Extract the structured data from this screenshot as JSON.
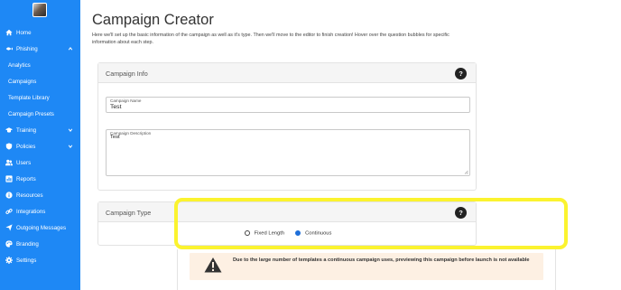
{
  "sidebar": {
    "items": [
      {
        "label": "Home",
        "icon": "home-icon",
        "chevron": false
      },
      {
        "label": "Phishing",
        "icon": "fish-icon",
        "chevron": "up"
      },
      {
        "label": "Analytics",
        "icon": "",
        "chevron": false
      },
      {
        "label": "Campaigns",
        "icon": "",
        "chevron": false
      },
      {
        "label": "Template Library",
        "icon": "",
        "chevron": false
      },
      {
        "label": "Campaign Presets",
        "icon": "",
        "chevron": false
      },
      {
        "label": "Training",
        "icon": "graduation-cap-icon",
        "chevron": "down"
      },
      {
        "label": "Policies",
        "icon": "shield-icon",
        "chevron": "down"
      },
      {
        "label": "Users",
        "icon": "users-icon",
        "chevron": false
      },
      {
        "label": "Reports",
        "icon": "bar-chart-icon",
        "chevron": false
      },
      {
        "label": "Resources",
        "icon": "info-icon",
        "chevron": false
      },
      {
        "label": "Integrations",
        "icon": "link-icon",
        "chevron": false
      },
      {
        "label": "Outgoing Messages",
        "icon": "send-icon",
        "chevron": false
      },
      {
        "label": "Branding",
        "icon": "palette-icon",
        "chevron": false
      },
      {
        "label": "Settings",
        "icon": "gear-icon",
        "chevron": false
      }
    ]
  },
  "page": {
    "title": "Campaign Creator",
    "intro": "Here we'll set up the basic information of the campaign as well as it's type. Then we'll move to the editor to finish creation! Hover over the question bubbles for specific information about each step."
  },
  "campaign_info": {
    "heading": "Campaign Info",
    "help": "?",
    "name_label": "Campaign Name",
    "name_value": "Test",
    "description_label": "Campaign Description",
    "description_value": "Test"
  },
  "campaign_type": {
    "heading": "Campaign Type",
    "help": "?",
    "options": [
      {
        "label": "Fixed Length",
        "selected": false
      },
      {
        "label": "Continuous",
        "selected": true
      }
    ]
  },
  "warning": {
    "text": "Due to the large number of templates a continuous campaign uses, previewing this campaign before launch is not available"
  },
  "colors": {
    "sidebar": "#1e88f5",
    "highlight": "#fbf32f",
    "radio_selected": "#1e6fd9",
    "warning_bg": "#fdf0e3"
  }
}
